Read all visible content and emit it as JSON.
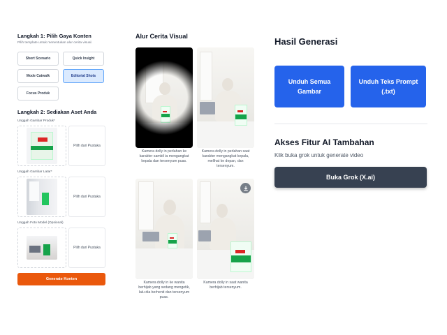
{
  "step1": {
    "title": "Langkah 1: Pilih Gaya Konten",
    "subtitle": "Pilih template untuk menentukan alur cerita visual.",
    "templates": [
      {
        "label": "Short Scenario",
        "active": false
      },
      {
        "label": "Quick Insight",
        "active": false
      },
      {
        "label": "Mode Catwalk",
        "active": false
      },
      {
        "label": "Editorial Shots",
        "active": true
      },
      {
        "label": "Focus Produk",
        "active": false
      }
    ]
  },
  "step2": {
    "title": "Langkah 2: Sediakan Aset Anda",
    "uploads": [
      {
        "label": "Unggah Gambar Produk*",
        "library": "Pilih dari Pustaka"
      },
      {
        "label": "Unggah Gambar Latar*",
        "library": "Pilih dari Pustaka"
      },
      {
        "label": "Unggah Foto Model (Opsional)",
        "library": "Pilih dari Pustaka"
      }
    ],
    "generate_label": "Generate Konten"
  },
  "story": {
    "title": "Alur Cerita Visual",
    "cards": [
      {
        "caption": "Kamera dolly in perlahan ke karakter sambil ia mengangkat kepala dan tersenyum puas."
      },
      {
        "caption": "Kamera dolly in perlahan saat karakter mengangkat kepala, melihat ke depan, dan tersenyum."
      },
      {
        "caption": "Kamera dolly in ke wanita berhijab yang sedang mengetik, lalu dia berhenti dan tersenyum puas."
      },
      {
        "caption": "Kamera dolly in saat wanita berhijab tersenyum."
      }
    ],
    "download_icon": "download-icon"
  },
  "result": {
    "title": "Hasil Generasi",
    "download_all": "Unduh Semua Gambar",
    "download_prompt": "Unduh Teks Prompt (.txt)"
  },
  "ai": {
    "title": "Akses Fitur AI Tambahan",
    "subtitle": "Klik buka grok untuk generate video",
    "grok_button": "Buka Grok (X.ai)"
  },
  "colors": {
    "primary_blue": "#2563eb",
    "generate_orange": "#ea580c",
    "dark_button": "#374151",
    "active_template": "#dbeafe"
  }
}
